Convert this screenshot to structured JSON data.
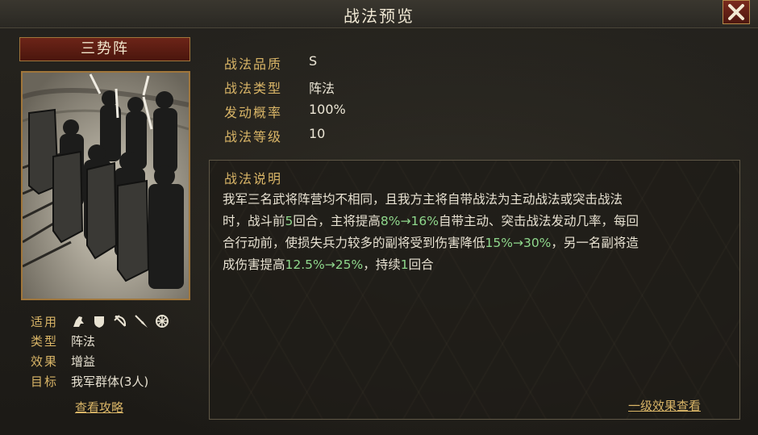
{
  "header": {
    "title": "战法预览"
  },
  "card": {
    "name": "三势阵"
  },
  "attributes": {
    "fit_label": "适用",
    "fit_icons": [
      "cavalry-icon",
      "shield-icon",
      "bow-icon",
      "spear-icon",
      "siege-icon"
    ],
    "type_label": "类型",
    "type_value": "阵法",
    "effect_label": "效果",
    "effect_value": "增益",
    "target_label": "目标",
    "target_value": "我军群体(3人)",
    "guide_link": "查看攻略"
  },
  "stats": [
    {
      "label": "战法品质",
      "value": "S"
    },
    {
      "label": "战法类型",
      "value": "阵法"
    },
    {
      "label": "发动概率",
      "value": "100%"
    },
    {
      "label": "战法等级",
      "value": "10"
    }
  ],
  "description": {
    "title": "战法说明",
    "line1": "我军三名武将阵营均不相同，且我方主将自带战法为主动战法或突击战法",
    "line2_a": "时，战斗前",
    "line2_hl1": "5",
    "line2_b": "回合，主将提高",
    "line2_hl2": "8%→16%",
    "line2_c": "自带主动、突击战法发动几率，每回",
    "line3_a": "合行动前，使损失兵力较多的副将受到伤害降低",
    "line3_hl": "15%→30%",
    "line3_b": "，另一名副将造",
    "line4_a": "成伤害提高",
    "line4_hl1": "12.5%→25%",
    "line4_b": "，持续",
    "line4_hl2": "1",
    "line4_c": "回合",
    "level_link": "一级效果查看"
  },
  "colors": {
    "gold": "#d9b567",
    "highlight": "#8fd88c",
    "title_red": "#6c2418"
  }
}
